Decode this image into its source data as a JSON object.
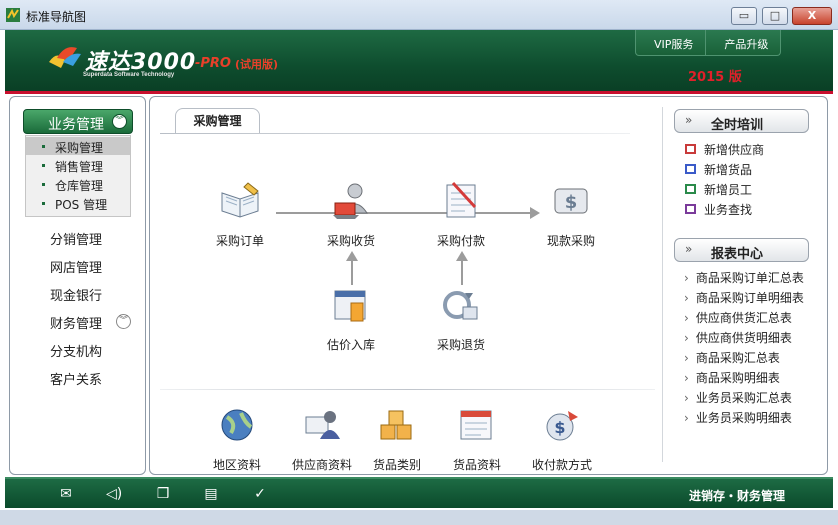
{
  "window": {
    "title": "标准导航图",
    "min_label": "▭",
    "max_label": "□",
    "close_label": "X"
  },
  "header": {
    "logo_text": "速达3000",
    "logo_sub": "Superdata Software Technology",
    "pro": "-PRO",
    "trial": "(试用版)",
    "links": [
      "VIP服务",
      "产品升级"
    ],
    "year": "2015 版"
  },
  "sidebar": {
    "group_label": "业务管理",
    "subitems": [
      "采购管理",
      "销售管理",
      "仓库管理",
      "POS 管理"
    ],
    "items": [
      "分销管理",
      "网店管理",
      "现金银行",
      "财务管理",
      "分支机构",
      "客户关系"
    ]
  },
  "main": {
    "tab": "采购管理",
    "flow": [
      "采购订单",
      "采购收货",
      "采购付款",
      "现款采购",
      "估价入库",
      "采购退货"
    ],
    "basics": [
      "地区资料",
      "供应商资料",
      "货品类别",
      "货品资料",
      "收付款方式"
    ]
  },
  "training": {
    "title": "全时培训",
    "items": [
      "新增供应商",
      "新增货品",
      "新增员工",
      "业务查找"
    ]
  },
  "reports": {
    "title": "报表中心",
    "items": [
      "商品采购订单汇总表",
      "商品采购订单明细表",
      "供应商供货汇总表",
      "供应商供货明细表",
      "商品采购汇总表",
      "商品采购明细表",
      "业务员采购汇总表",
      "业务员采购明细表"
    ]
  },
  "footer": {
    "text": "进销存・财务管理",
    "icons": [
      "mail-icon",
      "speaker-icon",
      "book-icon",
      "calculator-icon",
      "check-icon"
    ]
  },
  "colors": {
    "brand_green": "#0e4d2e",
    "accent_red": "#c8102e"
  }
}
